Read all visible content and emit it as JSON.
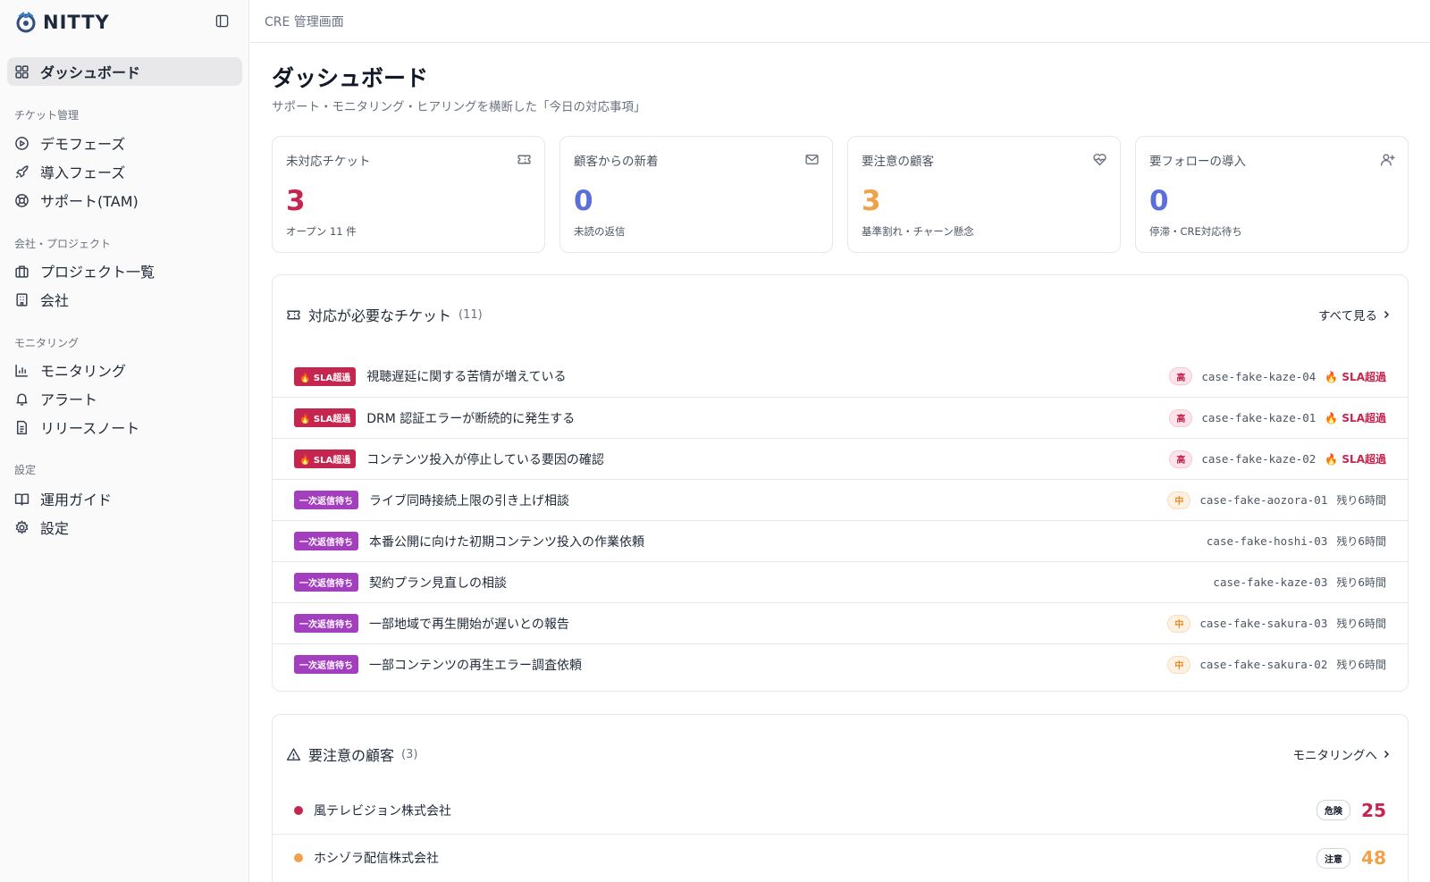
{
  "brand": {
    "name": "NITTY"
  },
  "topbar": {
    "breadcrumb": "CRE 管理画面"
  },
  "sidebar": {
    "dashboard": "ダッシュボード",
    "groups": [
      {
        "label": "チケット管理",
        "items": [
          "デモフェーズ",
          "導入フェーズ",
          "サポート(TAM)"
        ]
      },
      {
        "label": "会社・プロジェクト",
        "items": [
          "プロジェクト一覧",
          "会社"
        ]
      },
      {
        "label": "モニタリング",
        "items": [
          "モニタリング",
          "アラート",
          "リリースノート"
        ]
      },
      {
        "label": "設定",
        "items": [
          "運用ガイド",
          "設定"
        ]
      }
    ]
  },
  "page": {
    "title": "ダッシュボード",
    "subtitle": "サポート・モニタリング・ヒアリングを横断した「今日の対応事項」"
  },
  "stats": [
    {
      "label": "未対応チケット",
      "value": "3",
      "note": "オープン 11 件",
      "color": "#c5264f",
      "icon": "ticket-icon"
    },
    {
      "label": "顧客からの新着",
      "value": "0",
      "note": "未読の返信",
      "color": "#5b6fd8",
      "icon": "mail-icon"
    },
    {
      "label": "要注意の顧客",
      "value": "3",
      "note": "基準割れ・チャーン懸念",
      "color": "#f0a24a",
      "icon": "heart-pulse-icon"
    },
    {
      "label": "要フォローの導入",
      "value": "0",
      "note": "停滞・CRE対応待ち",
      "color": "#5b6fd8",
      "icon": "user-plus-icon"
    }
  ],
  "tickets_card": {
    "title": "対応が必要なチケット",
    "count": "(11)",
    "link": "すべて見る",
    "rows": [
      {
        "badge": "🔥 SLA超過",
        "type": "sla",
        "subject": "視聴遅延に関する苦情が増えている",
        "priority": "高",
        "priority_level": "high",
        "case_id": "case-fake-kaze-04",
        "status": "🔥 SLA超過",
        "status_type": "sla"
      },
      {
        "badge": "🔥 SLA超過",
        "type": "sla",
        "subject": "DRM 認証エラーが断続的に発生する",
        "priority": "高",
        "priority_level": "high",
        "case_id": "case-fake-kaze-01",
        "status": "🔥 SLA超過",
        "status_type": "sla"
      },
      {
        "badge": "🔥 SLA超過",
        "type": "sla",
        "subject": "コンテンツ投入が停止している要因の確認",
        "priority": "高",
        "priority_level": "high",
        "case_id": "case-fake-kaze-02",
        "status": "🔥 SLA超過",
        "status_type": "sla"
      },
      {
        "badge": "一次返信待ち",
        "type": "wait",
        "subject": "ライブ同時接続上限の引き上げ相談",
        "priority": "中",
        "priority_level": "mid",
        "case_id": "case-fake-aozora-01",
        "status": "残り6時間",
        "status_type": "remain"
      },
      {
        "badge": "一次返信待ち",
        "type": "wait",
        "subject": "本番公開に向けた初期コンテンツ投入の作業依頼",
        "priority": "",
        "priority_level": "",
        "case_id": "case-fake-hoshi-03",
        "status": "残り6時間",
        "status_type": "remain"
      },
      {
        "badge": "一次返信待ち",
        "type": "wait",
        "subject": "契約プラン見直しの相談",
        "priority": "",
        "priority_level": "",
        "case_id": "case-fake-kaze-03",
        "status": "残り6時間",
        "status_type": "remain"
      },
      {
        "badge": "一次返信待ち",
        "type": "wait",
        "subject": "一部地域で再生開始が遅いとの報告",
        "priority": "中",
        "priority_level": "mid",
        "case_id": "case-fake-sakura-03",
        "status": "残り6時間",
        "status_type": "remain"
      },
      {
        "badge": "一次返信待ち",
        "type": "wait",
        "subject": "一部コンテンツの再生エラー調査依頼",
        "priority": "中",
        "priority_level": "mid",
        "case_id": "case-fake-sakura-02",
        "status": "残り6時間",
        "status_type": "remain"
      }
    ]
  },
  "customers_card": {
    "title": "要注意の顧客",
    "count": "(3)",
    "link": "モニタリングへ",
    "rows": [
      {
        "name": "風テレビジョン株式会社",
        "level": "危険",
        "score": "25",
        "color": "#c5264f"
      },
      {
        "name": "ホシゾラ配信株式会社",
        "level": "注意",
        "score": "48",
        "color": "#f0a24a"
      }
    ]
  }
}
